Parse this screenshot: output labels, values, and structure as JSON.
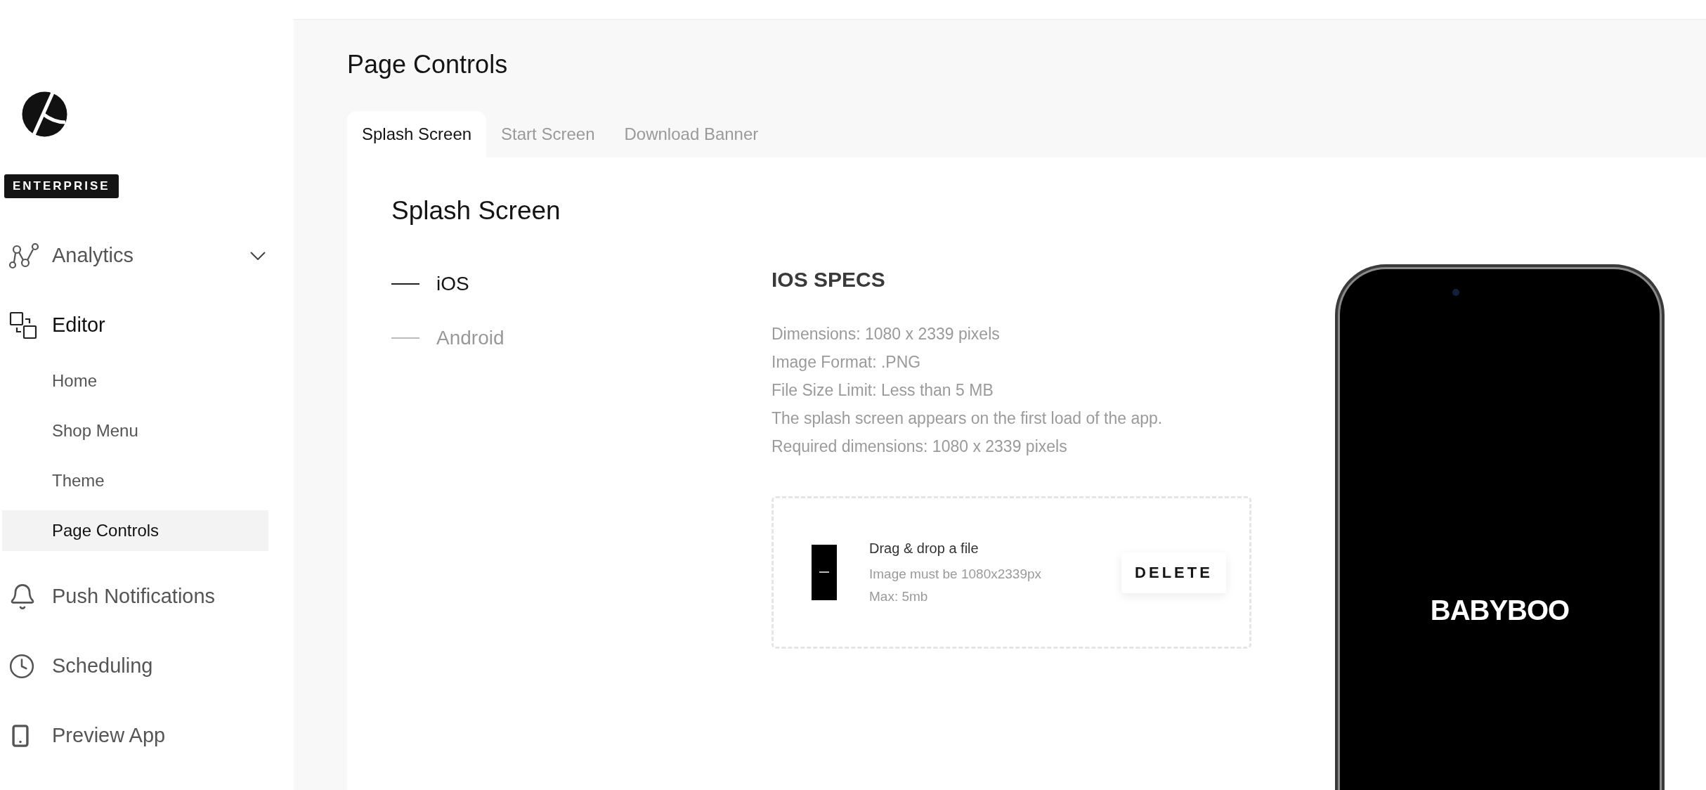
{
  "sidebar": {
    "badge": "ENTERPRISE",
    "items": [
      {
        "label": "Analytics",
        "expanded": false
      },
      {
        "label": "Editor",
        "children": [
          {
            "label": "Home",
            "selected": false
          },
          {
            "label": "Shop Menu",
            "selected": false
          },
          {
            "label": "Theme",
            "selected": false
          },
          {
            "label": "Page Controls",
            "selected": true
          }
        ]
      },
      {
        "label": "Push Notifications"
      },
      {
        "label": "Scheduling"
      },
      {
        "label": "Preview App"
      }
    ]
  },
  "page": {
    "title": "Page Controls"
  },
  "tabs": [
    {
      "label": "Splash Screen",
      "selected": true
    },
    {
      "label": "Start Screen",
      "selected": false
    },
    {
      "label": "Download Banner",
      "selected": false
    }
  ],
  "card": {
    "title": "Splash Screen",
    "platforms": [
      {
        "label": "iOS",
        "selected": true
      },
      {
        "label": "Android",
        "selected": false
      }
    ],
    "specs": {
      "title": "IOS SPECS",
      "lines": [
        "Dimensions: 1080 x 2339 pixels",
        "Image Format: .PNG",
        "File Size Limit: Less than 5 MB",
        "The splash screen appears on the first load of the app.",
        "Required dimensions: 1080 x 2339 pixels"
      ]
    },
    "upload": {
      "title": "Drag & drop a file",
      "hints": [
        "Image must be 1080x2339px",
        "Max: 5mb"
      ],
      "button": "DELETE"
    },
    "preview": {
      "brand": "BABYBOO"
    }
  }
}
